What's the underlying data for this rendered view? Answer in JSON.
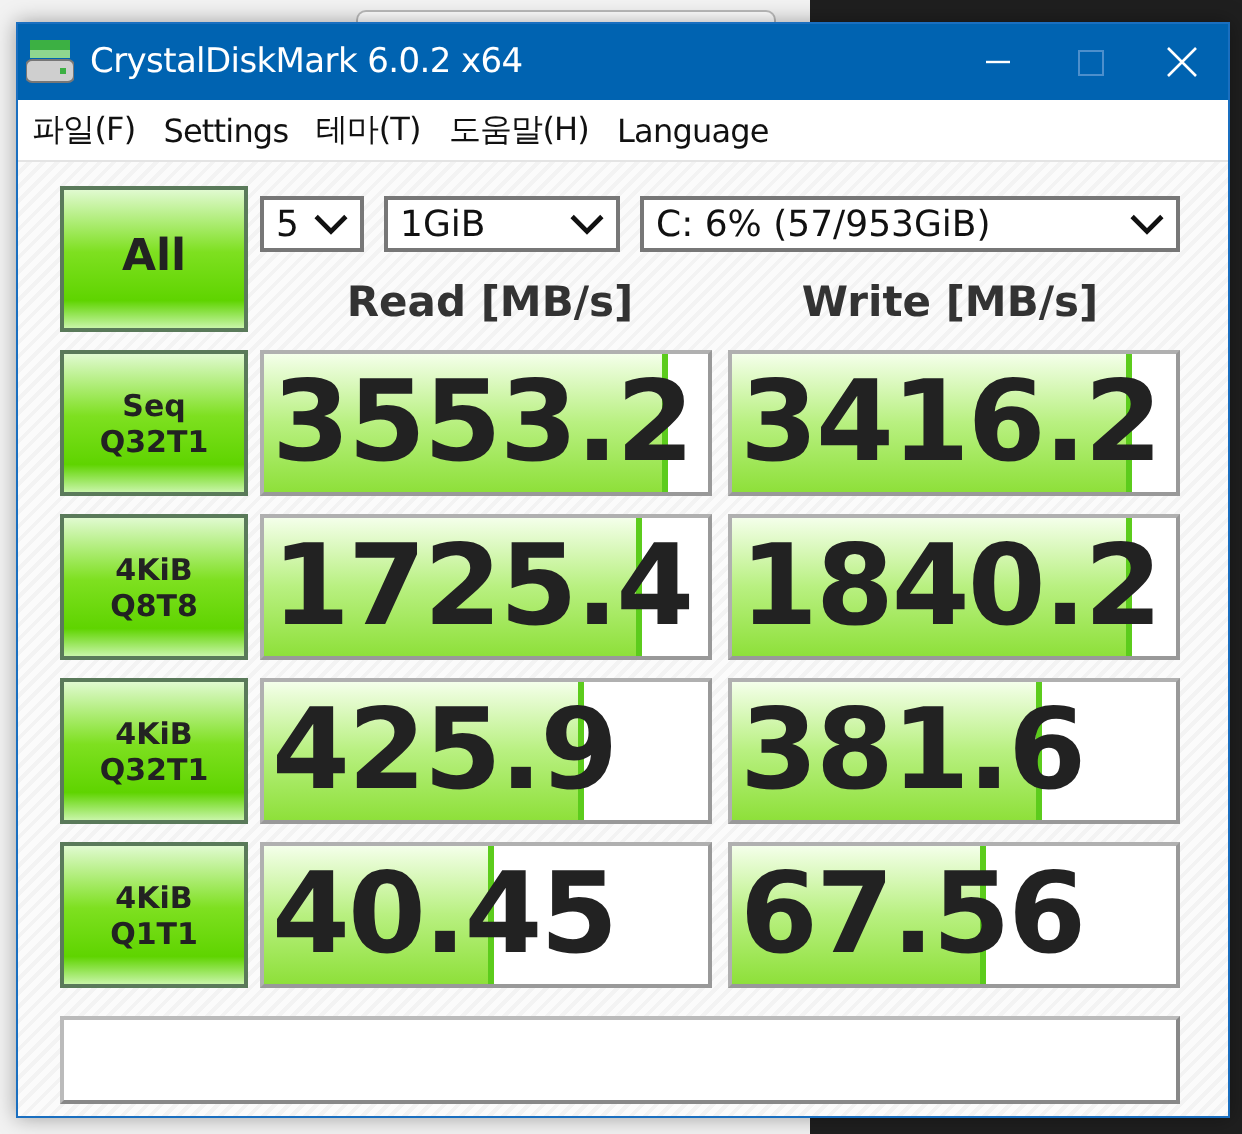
{
  "window": {
    "title": "CrystalDiskMark 6.0.2 x64"
  },
  "menu": [
    "파일(F)",
    "Settings",
    "테마(T)",
    "도움말(H)",
    "Language"
  ],
  "all_button": "All",
  "selects": {
    "count": "5",
    "size": "1GiB",
    "drive": "C: 6% (57/953GiB)"
  },
  "headers": [
    "Read [MB/s]",
    "Write [MB/s]"
  ],
  "rows": [
    {
      "label": [
        "Seq",
        "Q32T1"
      ],
      "read": {
        "value": "3553.2",
        "level": 0.91
      },
      "write": {
        "value": "3416.2",
        "level": 0.9
      }
    },
    {
      "label": [
        "4KiB",
        "Q8T8"
      ],
      "read": {
        "value": "1725.4",
        "level": 0.85
      },
      "write": {
        "value": "1840.2",
        "level": 0.9
      }
    },
    {
      "label": [
        "4KiB",
        "Q32T1"
      ],
      "read": {
        "value": "425.9",
        "level": 0.72
      },
      "write": {
        "value": "381.6",
        "level": 0.7
      }
    },
    {
      "label": [
        "4KiB",
        "Q1T1"
      ],
      "read": {
        "value": "40.45",
        "level": 0.52
      },
      "write": {
        "value": "67.56",
        "level": 0.57
      }
    }
  ]
}
